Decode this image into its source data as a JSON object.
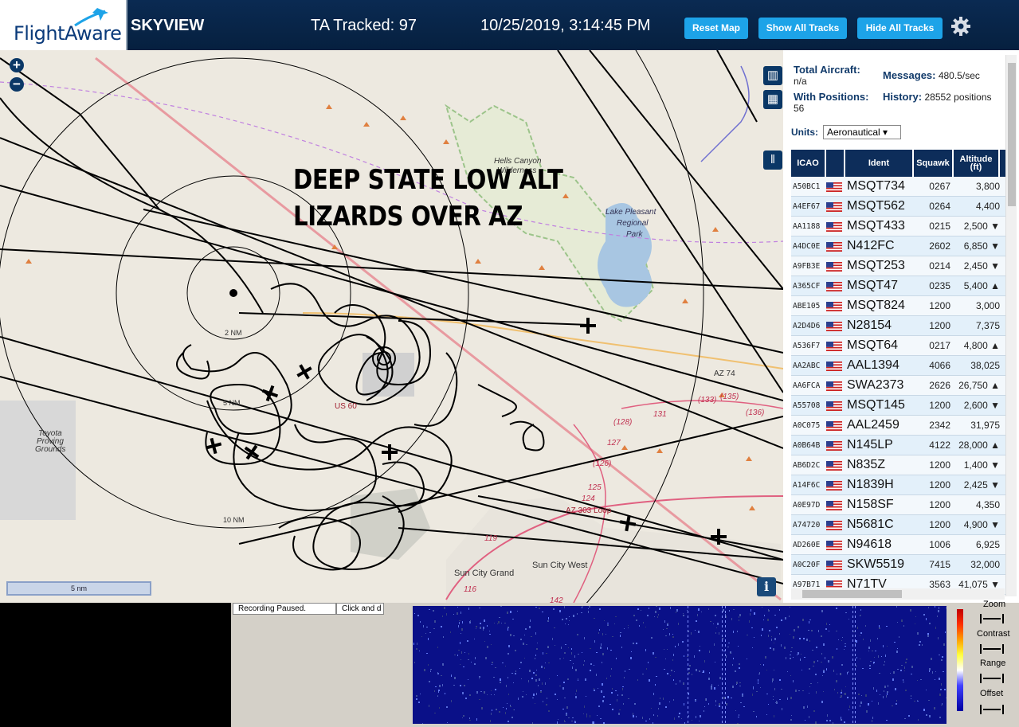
{
  "header": {
    "logo": "FlightAware",
    "title": "SKYVIEW",
    "tracked": "TA Tracked: 97",
    "datetime": "10/25/2019, 3:14:45 PM",
    "buttons": {
      "reset": "Reset Map",
      "show": "Show All Tracks",
      "hide": "Hide All Tracks"
    }
  },
  "map": {
    "zoom_in": "+",
    "zoom_out": "−",
    "banner_line1": "DEEP STATE LOW ALT",
    "banner_line2": "LIZARDS OVER AZ",
    "scale_label": "5 nm",
    "info": "i",
    "labels": {
      "hells_canyon": "Hells Canyon",
      "wilderness": "Wilderness",
      "lake_pleasant": "Lake Pleasant",
      "regional": "Regional",
      "park": "Park",
      "toyota1": "Toyota",
      "toyota2": "Proving",
      "toyota3": "Grounds",
      "az74": "AZ 74",
      "us60": "US 60",
      "az303": "AZ 303 Loop",
      "sun_city_grand": "Sun City Grand",
      "sun_city_west": "Sun City West",
      "ring2": "2 NM",
      "ring5": "5 NM",
      "ring10": "10 NM",
      "r128": "(128)",
      "r127": "127",
      "r131": "131",
      "r133": "(133)",
      "r135": "(135)",
      "r136": "(136)",
      "r126": "(126)",
      "r125": "125",
      "r124": "124",
      "r119": "119",
      "r116": "116",
      "r142": "142"
    }
  },
  "panel": {
    "total_label": "Total Aircraft:",
    "total_value": "n/a",
    "messages_label": "Messages:",
    "messages_value": "480.5/sec",
    "positions_label": "With Positions:",
    "positions_value": "56",
    "history_label": "History:",
    "history_value": "28552 positions",
    "units_label": "Units:",
    "units_value": "Aeronautical ▾",
    "columns": {
      "icao": "ICAO",
      "ident": "Ident",
      "squawk": "Squawk",
      "altitude": "Altitude (ft)"
    },
    "rows": [
      {
        "icao": "A50BC1",
        "ident": "MSQT734",
        "squawk": "0267",
        "alt": "3,800"
      },
      {
        "icao": "A4EF67",
        "ident": "MSQT562",
        "squawk": "0264",
        "alt": "4,400"
      },
      {
        "icao": "AA1188",
        "ident": "MSQT433",
        "squawk": "0215",
        "alt": "2,500 ▼"
      },
      {
        "icao": "A4DC0E",
        "ident": "N412FC",
        "squawk": "2602",
        "alt": "6,850 ▼"
      },
      {
        "icao": "A9FB3E",
        "ident": "MSQT253",
        "squawk": "0214",
        "alt": "2,450 ▼"
      },
      {
        "icao": "A365CF",
        "ident": "MSQT47",
        "squawk": "0235",
        "alt": "5,400 ▲"
      },
      {
        "icao": "ABE105",
        "ident": "MSQT824",
        "squawk": "1200",
        "alt": "3,000"
      },
      {
        "icao": "A2D4D6",
        "ident": "N28154",
        "squawk": "1200",
        "alt": "7,375"
      },
      {
        "icao": "A536F7",
        "ident": "MSQT64",
        "squawk": "0217",
        "alt": "4,800 ▲"
      },
      {
        "icao": "AA2ABC",
        "ident": "AAL1394",
        "squawk": "4066",
        "alt": "38,025"
      },
      {
        "icao": "AA6FCA",
        "ident": "SWA2373",
        "squawk": "2626",
        "alt": "26,750 ▲"
      },
      {
        "icao": "A55708",
        "ident": "MSQT145",
        "squawk": "1200",
        "alt": "2,600 ▼"
      },
      {
        "icao": "A0C075",
        "ident": "AAL2459",
        "squawk": "2342",
        "alt": "31,975"
      },
      {
        "icao": "A0B64B",
        "ident": "N145LP",
        "squawk": "4122",
        "alt": "28,000 ▲"
      },
      {
        "icao": "AB6D2C",
        "ident": "N835Z",
        "squawk": "1200",
        "alt": "1,400 ▼"
      },
      {
        "icao": "A14F6C",
        "ident": "N1839H",
        "squawk": "1200",
        "alt": "2,425 ▼"
      },
      {
        "icao": "A0E97D",
        "ident": "N158SF",
        "squawk": "1200",
        "alt": "4,350"
      },
      {
        "icao": "A74720",
        "ident": "N5681C",
        "squawk": "1200",
        "alt": "4,900 ▼"
      },
      {
        "icao": "AD260E",
        "ident": "N94618",
        "squawk": "1006",
        "alt": "6,925"
      },
      {
        "icao": "A0C20F",
        "ident": "SKW5519",
        "squawk": "7415",
        "alt": "32,000"
      },
      {
        "icao": "A97B71",
        "ident": "N71TV",
        "squawk": "3563",
        "alt": "41,075 ▼"
      }
    ]
  },
  "bottom": {
    "status1": "Recording Paused.",
    "status2": "Click and d",
    "zoom": "Zoom",
    "contrast": "Contrast",
    "range": "Range",
    "offset": "Offset"
  }
}
